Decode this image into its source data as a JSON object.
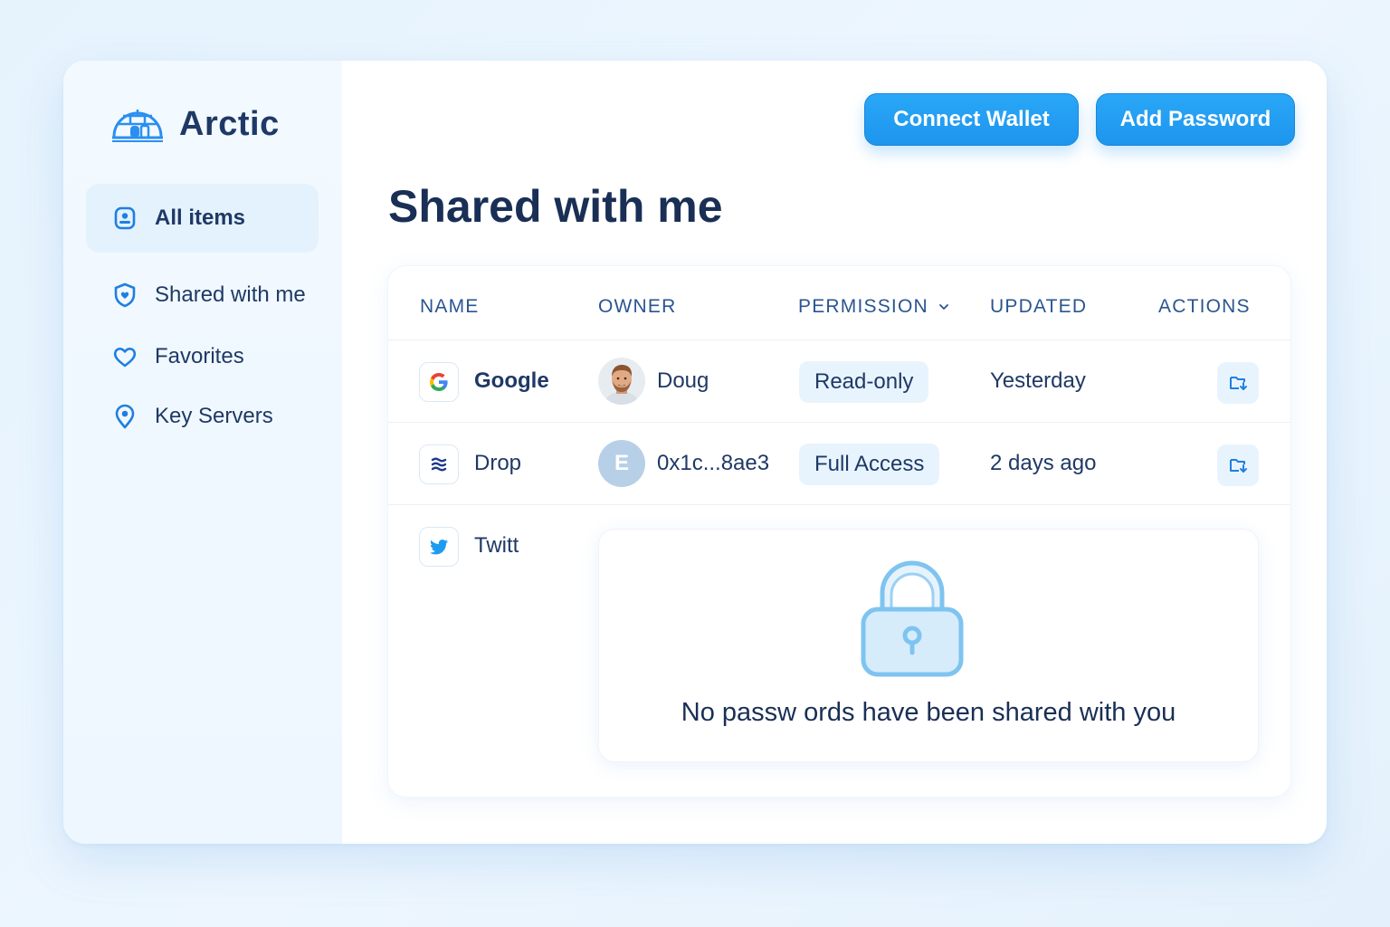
{
  "app": {
    "name": "Arctic"
  },
  "sidebar": {
    "items": [
      {
        "label": "All items",
        "icon": "user-card-icon",
        "active": true
      },
      {
        "label": "Shared with me",
        "icon": "shield-heart-icon",
        "active": false
      },
      {
        "label": "Favorites",
        "icon": "heart-icon",
        "active": false
      },
      {
        "label": "Key Servers",
        "icon": "map-pin-icon",
        "active": false
      }
    ]
  },
  "header": {
    "connect_wallet_label": "Connect Wallet",
    "add_password_label": "Add Password"
  },
  "page": {
    "title": "Shared with me"
  },
  "table": {
    "columns": [
      "NAME",
      "OWNER",
      "PERMISSION",
      "UPDATED",
      "ACTIONS"
    ],
    "rows": [
      {
        "name": "Google",
        "icon": "google-icon",
        "owner": "Doug",
        "owner_avatar": "photo",
        "permission": "Read-only",
        "updated": "Yesterday"
      },
      {
        "name": "Drop",
        "icon": "drop-icon",
        "owner": "0x1c...8ae3",
        "owner_avatar": "E",
        "permission": "Full Access",
        "updated": "2 days ago"
      },
      {
        "name": "Twitt",
        "icon": "twitter-icon"
      }
    ]
  },
  "empty_state": {
    "icon": "lock-icon",
    "message": "No passw ords have been shared with you"
  },
  "colors": {
    "accent": "#1d95ee",
    "title": "#1a2f55",
    "badge_bg": "#e8f4fd",
    "sidebar_bg": "#f2f9ff"
  }
}
